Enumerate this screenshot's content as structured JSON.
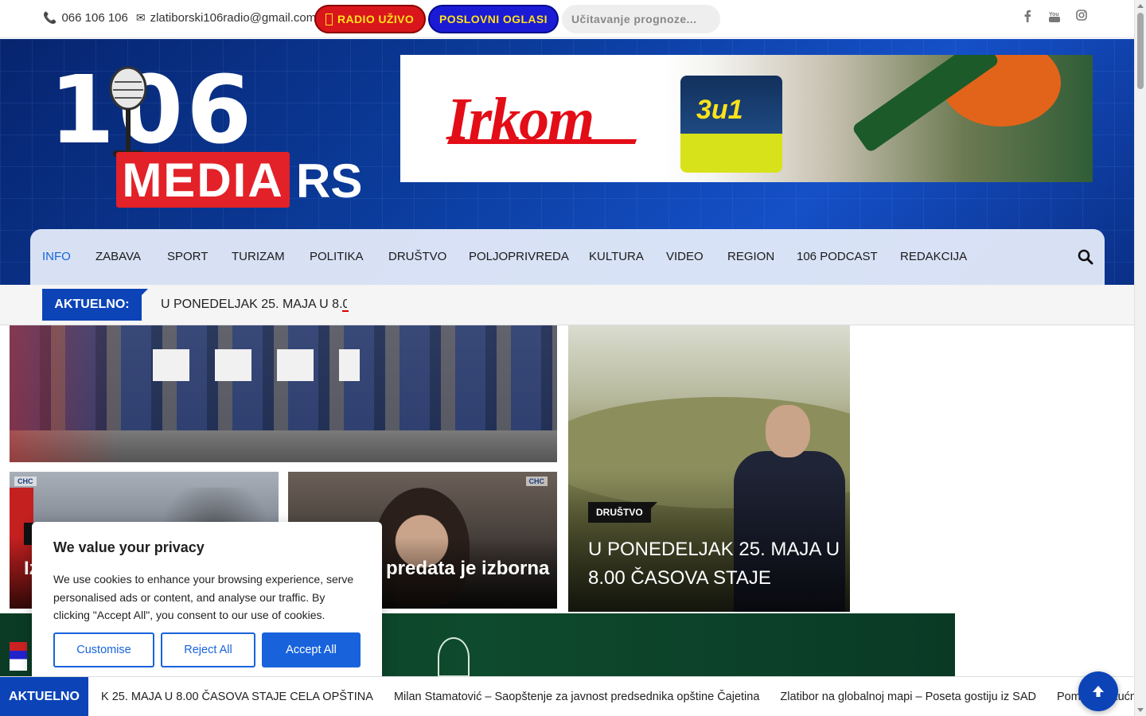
{
  "topbar": {
    "phone": "066 106 106",
    "email": "zlatiborski106radio@gmail.com",
    "radio_label": "RADIO UŽIVO",
    "oglasi_label": "POSLOVNI OGLASI",
    "weather_label": "Učitavanje prognoze...",
    "social": [
      "facebook-icon",
      "youtube-icon",
      "instagram-icon"
    ]
  },
  "logo": {
    "number": "106",
    "media": "MEDIA",
    "rs": "RS"
  },
  "banner": {
    "brand": "Irkom",
    "product": "3u1"
  },
  "nav": {
    "items": [
      "INFO",
      "ZABAVA",
      "SPORT",
      "TURIZAM",
      "POLITIKA",
      "DRUŠTVO",
      "POLJOPRIVREDA",
      "KULTURA",
      "VIDEO",
      "REGION",
      "106 PODCAST",
      "REDAKCIJA"
    ],
    "active": "INFO"
  },
  "ticker": {
    "label": "AKTUELNO:",
    "text": "U PONEDELJAK 25. MAJA U 8.0"
  },
  "cards": {
    "card2_title": "Iz",
    "card3_title": "predata je izborna",
    "card4_tag": "DRUŠTVO",
    "card4_title": "U PONEDELJAK 25. MAJA U 8.00 ČASOVA STAJE",
    "sns_mark": "СНС"
  },
  "cookie": {
    "title": "We value your privacy",
    "text": "We use cookies to enhance your browsing experience, serve personalised ads or content, and analyse our traffic. By clicking \"Accept All\", you consent to our use of cookies.",
    "customise": "Customise",
    "reject": "Reject All",
    "accept": "Accept All"
  },
  "bottom_ticker": {
    "label": "AKTUELNO",
    "items": [
      "K 25. MAJA U 8.00 ČASOVA STAJE CELA OPŠTINA",
      "Milan Stamatović – Saopštenje za javnost predsednika opštine Čajetina",
      "Zlatibor na globalnoj mapi – Poseta gostiju iz SAD",
      "Pomoć na kućnoj adresi: Usluga: G"
    ]
  },
  "colors": {
    "accent": "#0c44b8",
    "red": "#e32128",
    "nav_active": "#1565d8",
    "cookie_blue": "#1863dc"
  }
}
